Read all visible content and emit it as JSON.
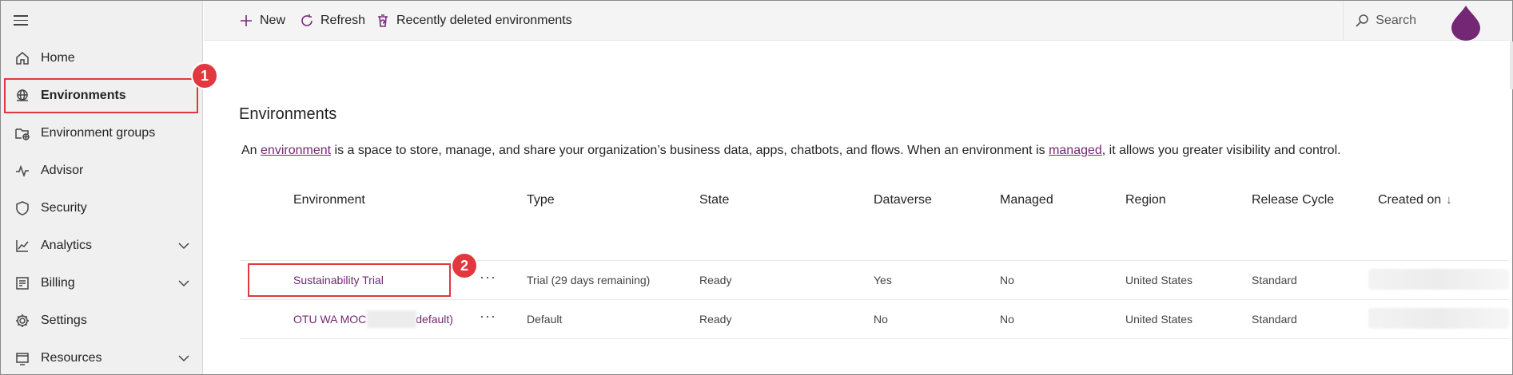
{
  "sidebar": {
    "items": [
      {
        "label": "Home",
        "icon": "home-icon"
      },
      {
        "label": "Environments",
        "icon": "globe-icon",
        "active": true
      },
      {
        "label": "Environment groups",
        "icon": "folder-globe-icon"
      },
      {
        "label": "Advisor",
        "icon": "pulse-icon"
      },
      {
        "label": "Security",
        "icon": "shield-icon"
      },
      {
        "label": "Analytics",
        "icon": "chart-icon",
        "expandable": true
      },
      {
        "label": "Billing",
        "icon": "billing-icon",
        "expandable": true
      },
      {
        "label": "Settings",
        "icon": "gear-icon"
      },
      {
        "label": "Resources",
        "icon": "resources-icon",
        "expandable": true
      }
    ]
  },
  "callouts": {
    "one": "1",
    "two": "2"
  },
  "toolbar": {
    "new_label": "New",
    "refresh_label": "Refresh",
    "recently_deleted_label": "Recently deleted environments",
    "search_placeholder": "Search"
  },
  "colors": {
    "accent": "#742774",
    "callout": "#e0383e"
  },
  "main": {
    "title": "Environments",
    "description": {
      "part1": "An ",
      "link1": "environment",
      "part2": " is a space to store, manage, and share your organization’s business data, apps, chatbots, and flows. When an environment is ",
      "link2": "managed",
      "part3": ", it allows you greater visibility and control."
    },
    "columns": [
      "Environment",
      "Type",
      "State",
      "Dataverse",
      "Managed",
      "Region",
      "Release Cycle",
      "Created on"
    ],
    "sort_arrow": "↓",
    "rows": [
      {
        "environment": "Sustainability Trial",
        "type": "Trial (29 days remaining)",
        "state": "Ready",
        "dataverse": "Yes",
        "managed": "No",
        "region": "United States",
        "release_cycle": "Standard"
      },
      {
        "environment_left": "OTU WA MOC",
        "environment_right": "default)",
        "type": "Default",
        "state": "Ready",
        "dataverse": "No",
        "managed": "No",
        "region": "United States",
        "release_cycle": "Standard"
      }
    ],
    "more_label": "···"
  }
}
